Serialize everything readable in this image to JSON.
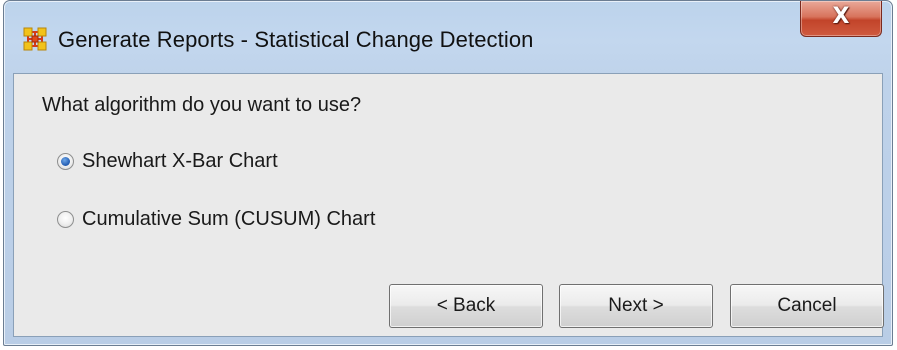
{
  "window": {
    "title": "Generate Reports - Statistical Change Detection",
    "app_icon": "network-grid-icon",
    "close_icon": "close-icon",
    "close_glyph": "X"
  },
  "dialog": {
    "question": "What algorithm do you want to use?",
    "options": [
      {
        "label": "Shewhart X-Bar Chart",
        "selected": true
      },
      {
        "label": "Cumulative Sum (CUSUM) Chart",
        "selected": false
      }
    ]
  },
  "buttons": {
    "back_label": "< Back",
    "next_label": "Next >",
    "cancel_label": "Cancel"
  },
  "colors": {
    "titlebar": "#bfd4ec",
    "client_bg": "#eaeaea",
    "close_button": "#c2442a",
    "radio_dot": "#2a64b8"
  }
}
